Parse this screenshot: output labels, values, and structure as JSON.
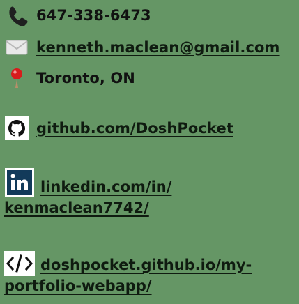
{
  "contact": {
    "phone": "647-338-6473",
    "email": "kenneth.maclean@gmail.com",
    "location": "Toronto, ON",
    "github": "github.com/DoshPocket",
    "linkedin_line1": "linkedin.com/in/",
    "linkedin_line2": "kenmaclean7742/",
    "portfolio_line1": "doshpocket.github.io/my-",
    "portfolio_line2": "portfolio-webapp/"
  },
  "icons": {
    "phone": "phone-icon",
    "email": "envelope-icon",
    "location": "location-pin-icon",
    "github": "github-icon",
    "linkedin": "linkedin-icon",
    "portfolio": "code-icon"
  },
  "colors": {
    "background": "#659665",
    "text": "#111111",
    "link": "#0f1b10",
    "linkedin_blue": "#123a5a",
    "pin_red": "#d81c1c"
  }
}
